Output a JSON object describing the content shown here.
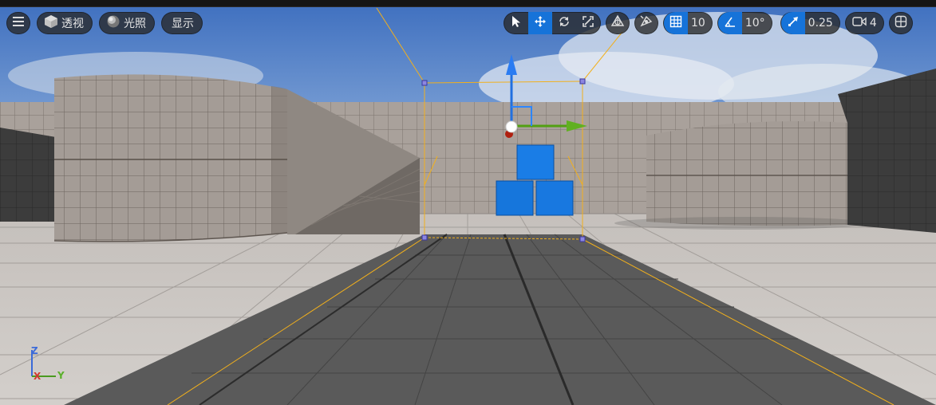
{
  "toolbar": {
    "menu_icon": "hamburger-menu-icon",
    "perspective_label": "透视",
    "lighting_label": "光照",
    "show_label": "显示",
    "grid_snap_value": "10",
    "rotation_snap_value": "10°",
    "scale_snap_value": "0.25",
    "camera_speed_value": "4"
  },
  "colors": {
    "accent": "#1673d9",
    "sky": "#4a78c2",
    "floor": "#c9c4c0",
    "cube": "#1878e0",
    "selection": "#f2b01c"
  },
  "axis_labels": {
    "z": "Z",
    "x": "X",
    "y": "Y"
  }
}
